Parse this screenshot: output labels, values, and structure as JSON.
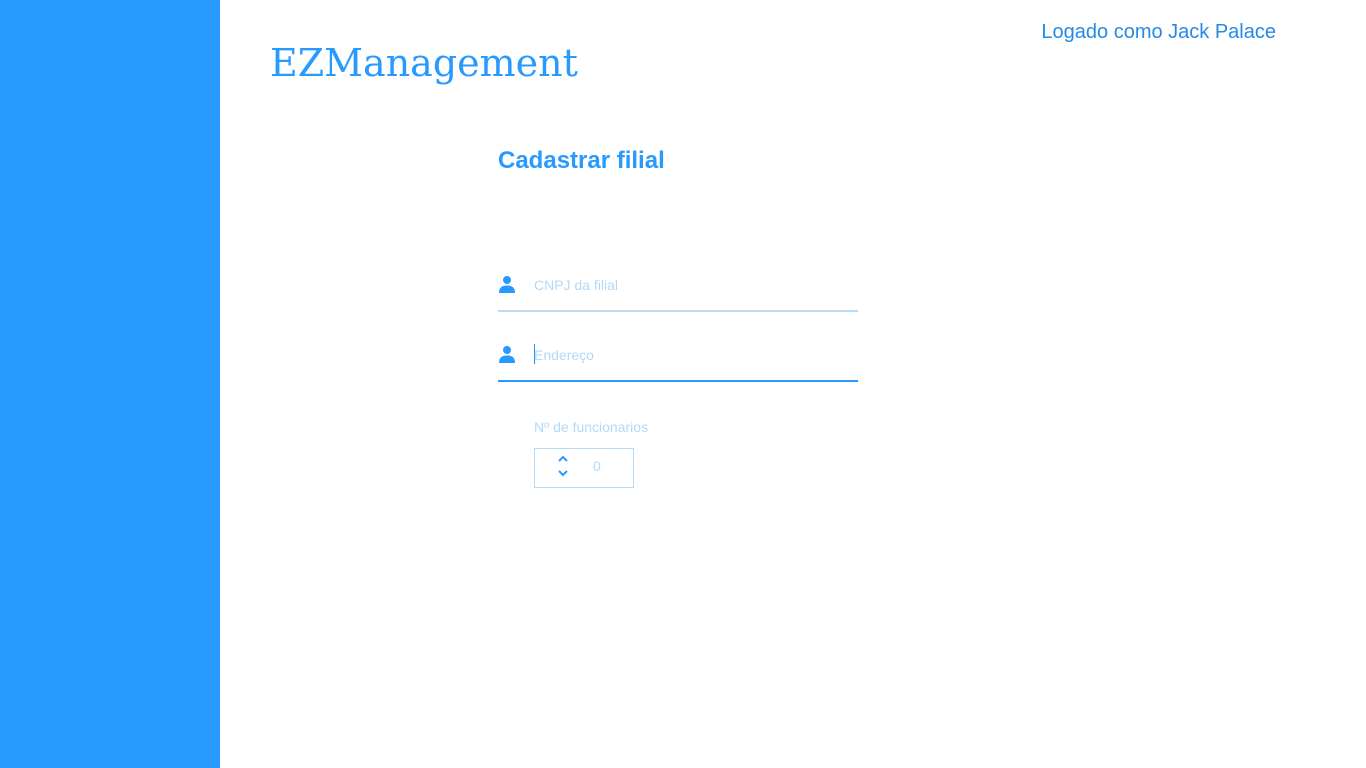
{
  "brand": {
    "name": "EZManagement"
  },
  "header": {
    "user_label": "Logado como Jack Palace"
  },
  "form": {
    "title": "Cadastrar filial",
    "cnpj": {
      "placeholder": "CNPJ da filial",
      "value": "",
      "icon": "person-icon"
    },
    "endereco": {
      "placeholder": "Endereço",
      "value": "",
      "icon": "person-icon",
      "focused": true
    },
    "funcionarios": {
      "label": "Nº de funcionarios",
      "value": "0",
      "icon": "stepper-arrows-icon"
    }
  },
  "colors": {
    "accent": "#2899ff",
    "sidebar": "#2899ff",
    "placeholder": "#b3d9f7",
    "inactive_border": "#b8dcf8"
  }
}
